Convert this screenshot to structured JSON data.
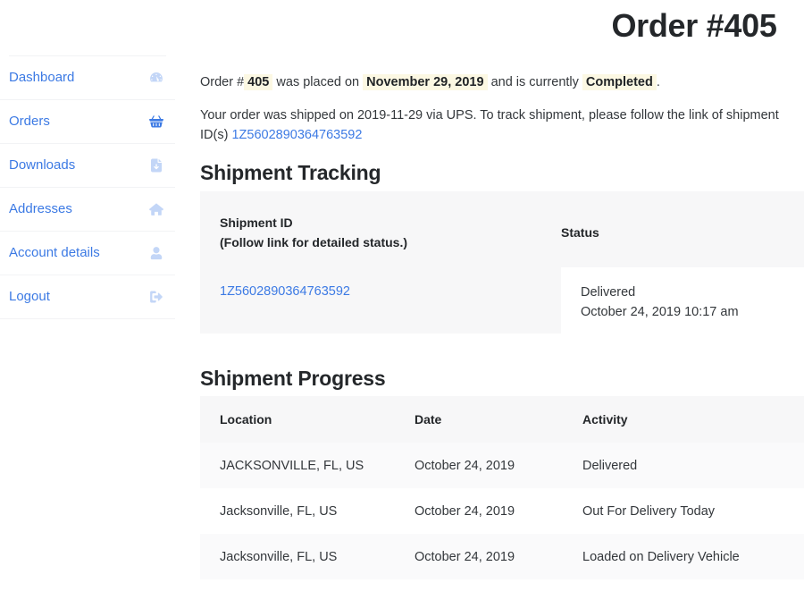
{
  "page": {
    "title": "Order #405"
  },
  "sidebar": {
    "items": [
      {
        "label": "Dashboard",
        "icon": "dashboard-gauge-icon",
        "active": false
      },
      {
        "label": "Orders",
        "icon": "shopping-basket-icon",
        "active": true
      },
      {
        "label": "Downloads",
        "icon": "download-file-icon",
        "active": false
      },
      {
        "label": "Addresses",
        "icon": "home-icon",
        "active": false
      },
      {
        "label": "Account details",
        "icon": "user-icon",
        "active": false
      },
      {
        "label": "Logout",
        "icon": "sign-out-icon",
        "active": false
      }
    ]
  },
  "main": {
    "intro": {
      "prefix": "Order #",
      "order_number": "405",
      "mid": "was placed on",
      "order_date": "November 29, 2019",
      "and_currently": "and is currently",
      "status": "Completed",
      "period": "."
    },
    "shipped_note": {
      "text": "Your order was shipped on 2019-11-29 via UPS. To track shipment, please follow the link of shipment ID(s)",
      "shipment_link": "1Z5602890364763592"
    },
    "tracking": {
      "heading": "Shipment Tracking",
      "col_shipment_id": "Shipment ID",
      "col_shipment_id_note": "(Follow link for detailed status.)",
      "col_status": "Status",
      "row": {
        "shipment_id": "1Z5602890364763592",
        "status": "Delivered",
        "status_time": "October 24, 2019 10:17 am"
      }
    },
    "progress": {
      "heading": "Shipment Progress",
      "columns": [
        "Location",
        "Date",
        "Activity"
      ],
      "rows": [
        {
          "location": "JACKSONVILLE, FL, US",
          "date": "October 24, 2019",
          "activity": "Delivered"
        },
        {
          "location": "Jacksonville, FL, US",
          "date": "October 24, 2019",
          "activity": "Out For Delivery Today"
        },
        {
          "location": "Jacksonville, FL, US",
          "date": "October 24, 2019",
          "activity": "Loaded on Delivery Vehicle"
        }
      ]
    }
  },
  "colors": {
    "link": "#3c7ae4",
    "icon_dim": "#c3d6f7",
    "highlight_bg": "#fcf8e3",
    "table_head_bg": "#f7f7f8",
    "row_alt_bg": "#fafafb",
    "heading": "#24272a"
  }
}
